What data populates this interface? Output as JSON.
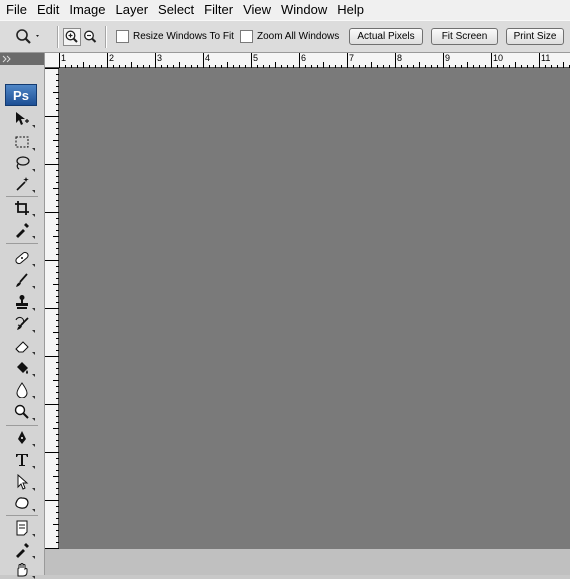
{
  "menubar": {
    "items": [
      "File",
      "Edit",
      "Image",
      "Layer",
      "Select",
      "Filter",
      "View",
      "Window",
      "Help"
    ]
  },
  "options": {
    "resize_windows_label": "Resize Windows To Fit",
    "zoom_all_label": "Zoom All Windows",
    "actual_pixels": "Actual Pixels",
    "fit_screen": "Fit Screen",
    "print_size": "Print Size"
  },
  "toolbox": {
    "logo": "Ps",
    "tools": [
      "move",
      "marquee",
      "lasso",
      "magic-wand",
      "crop",
      "eyedropper",
      "healing-brush",
      "brush",
      "clone-stamp",
      "history-brush",
      "eraser",
      "paint-bucket",
      "blur",
      "dodge",
      "pen",
      "type",
      "path-selection",
      "custom-shape",
      "notes",
      "eyedropper-2",
      "hand"
    ]
  },
  "ruler": {
    "top_labels": [
      "1",
      "2",
      "3",
      "4",
      "5",
      "6",
      "7",
      "8",
      "9",
      "10",
      "11"
    ]
  },
  "colors": {
    "menubar": "#f0f0f0",
    "options_bar": "#dcdcdc",
    "toolbox": "#d4d4d4",
    "workspace": "#c0c0c0"
  }
}
